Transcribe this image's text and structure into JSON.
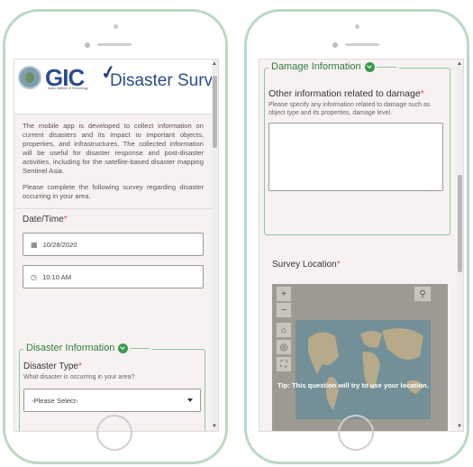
{
  "left_screen": {
    "logo": {
      "brand": "GIC",
      "product": "Disaster Survey",
      "subtitle": "Asian Institute of Technology"
    },
    "intro_paragraphs": [
      "The mobile app is developed to collect information on current disasters and its impact to important objects, properties, and infrastructures. The collected information will be useful for disaster response and post-disaster activities, including for the satellite-based disaster mapping Sentinel Asia.",
      "Please complete the following survey regarding disaster occurring in your area."
    ],
    "datetime": {
      "label": "Date/Time",
      "required_mark": "*",
      "date_value": "10/28/2020",
      "time_value": "10:10 AM",
      "date_icon": "calendar-icon",
      "time_icon": "clock-icon"
    },
    "disaster_info": {
      "title": "Disaster Information",
      "type_label": "Disaster Type",
      "required_mark": "*",
      "type_hint": "What disaster is occurring in your area?",
      "select_value": "-Please Select-"
    }
  },
  "right_screen": {
    "damage": {
      "title": "Damage Information",
      "question": "Other information related to damage",
      "required_mark": "*",
      "hint": "Please specify any information related to damage such as object type and its properties, damage level.",
      "answer": ""
    },
    "location": {
      "label": "Survey Location",
      "required_mark": "*",
      "tip": "Tip: This question will try to use your location.",
      "controls": {
        "zoom_in": "+",
        "zoom_out": "−",
        "search_icon": "search-icon",
        "home_icon": "home-icon",
        "locate_icon": "locate-icon",
        "fullscreen_icon": "fullscreen-icon"
      }
    }
  },
  "colors": {
    "accent_green": "#2f7e3f",
    "required_red": "#d9534f",
    "frame_green": "#b9d9c2",
    "screen_bg": "#f7f2f1"
  }
}
